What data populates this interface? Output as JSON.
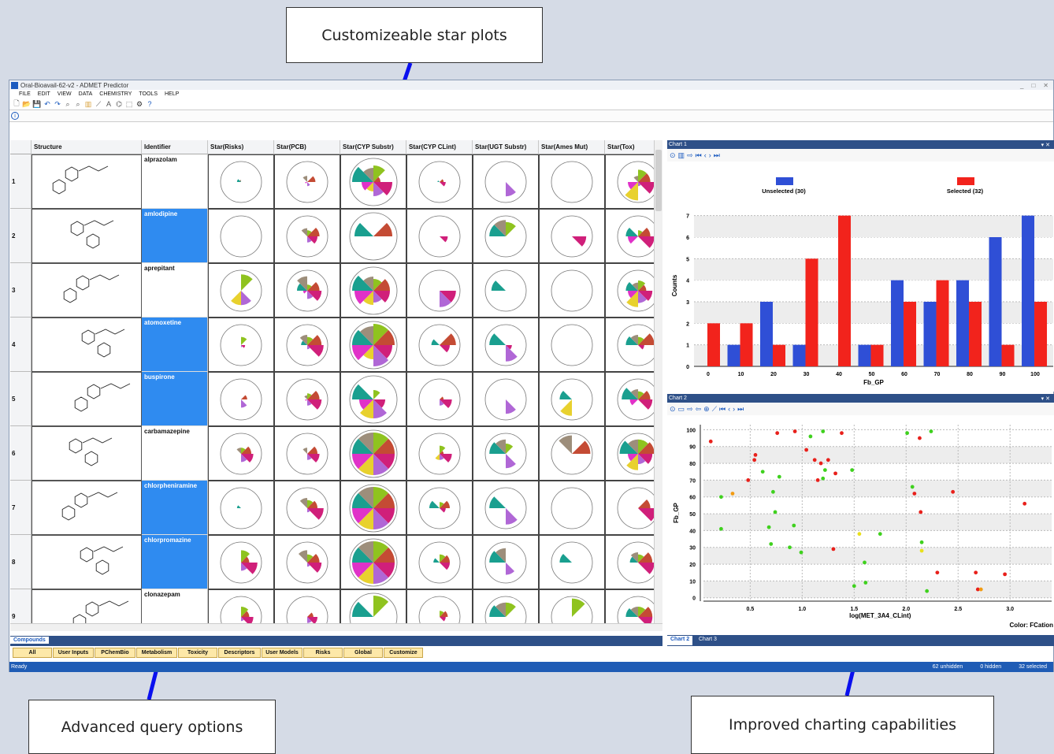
{
  "callouts": {
    "star_plots": "Customizeable star plots",
    "query": "Advanced query options",
    "charting": "Improved charting capabilities"
  },
  "window": {
    "title": "Oral-Bioavail-62-v2 - ADMET Predictor",
    "min": "_",
    "max": "□",
    "close": "✕"
  },
  "menu": [
    "FILE",
    "EDIT",
    "VIEW",
    "DATA",
    "CHEMISTRY",
    "TOOLS",
    "HELP"
  ],
  "toolbar_icons": [
    "new-icon",
    "open-icon",
    "save-icon",
    "undo-icon",
    "redo-icon",
    "find-icon",
    "find-replace-icon",
    "chart-icon",
    "plot-icon",
    "text-icon",
    "structure-icon",
    "select-icon",
    "settings-icon",
    "help-icon"
  ],
  "grid": {
    "headers": [
      "Structure",
      "Identifier",
      "Star(Risks)",
      "Star(PCB)",
      "Star(CYP Substr)",
      "Star(CYP CLint)",
      "Star(UGT Substr)",
      "Star(Ames Mut)",
      "Star(Tox)"
    ],
    "rows": [
      {
        "num": "1",
        "id": "alprazolam",
        "selected": false
      },
      {
        "num": "2",
        "id": "amlodipine",
        "selected": true
      },
      {
        "num": "3",
        "id": "aprepitant",
        "selected": false
      },
      {
        "num": "4",
        "id": "atomoxetine",
        "selected": true
      },
      {
        "num": "5",
        "id": "buspirone",
        "selected": true
      },
      {
        "num": "6",
        "id": "carbamazepine",
        "selected": false
      },
      {
        "num": "7",
        "id": "chlorpheniramine",
        "selected": true
      },
      {
        "num": "8",
        "id": "chlorpromazine",
        "selected": true
      },
      {
        "num": "9",
        "id": "clonazepam",
        "selected": false
      }
    ],
    "star_colors": [
      "#8fc31f",
      "#c44b34",
      "#d01f7a",
      "#b067d6",
      "#e8d12e",
      "#e032c8",
      "#1a9f8f",
      "#9d8e7b"
    ],
    "stars": [
      [
        [
          0,
          0,
          0,
          0,
          0,
          0,
          0.2,
          0.1
        ],
        [
          0,
          0.4,
          0,
          0.2,
          0,
          0.1,
          0,
          0.3
        ],
        [
          0.7,
          0.3,
          0.8,
          0.6,
          0.4,
          0.5,
          0.9,
          0.6
        ],
        [
          0,
          0.2,
          0.3,
          0,
          0,
          0,
          0.1,
          0
        ],
        [
          0,
          0,
          0,
          0.7,
          0,
          0,
          0,
          0
        ],
        [
          0,
          0,
          0,
          0,
          0,
          0,
          0,
          0
        ],
        [
          0.6,
          0.6,
          0.8,
          0.2,
          0.9,
          0.5,
          0,
          0.3
        ]
      ],
      [
        [
          0,
          0,
          0,
          0,
          0,
          0,
          0,
          0
        ],
        [
          0.3,
          0.6,
          0.5,
          0.3,
          0,
          0,
          0,
          0.4
        ],
        [
          0,
          0.8,
          0,
          0,
          0,
          0,
          0.8,
          0
        ],
        [
          0,
          0,
          0.4,
          0,
          0,
          0,
          0,
          0
        ],
        [
          0.7,
          0,
          0,
          0,
          0,
          0,
          0.8,
          0.8
        ],
        [
          0,
          0,
          0.7,
          0,
          0,
          0,
          0,
          0
        ],
        [
          0.3,
          0.6,
          0.8,
          0,
          0,
          0.5,
          0.6,
          0
        ]
      ],
      [
        [
          0.8,
          0,
          0,
          0.7,
          0.7,
          0,
          0,
          0
        ],
        [
          0.3,
          0.6,
          0.7,
          0.4,
          0,
          0.2,
          0.5,
          0.7
        ],
        [
          0.5,
          0.7,
          0.7,
          0.5,
          0.6,
          0.8,
          0.9,
          0.6
        ],
        [
          0,
          0,
          0.8,
          0.8,
          0,
          0,
          0,
          0
        ],
        [
          0,
          0,
          0,
          0,
          0,
          0,
          0.7,
          0
        ],
        [
          0,
          0,
          0,
          0,
          0,
          0,
          0,
          0
        ],
        [
          0.5,
          0.4,
          0.7,
          0.6,
          0.8,
          0.5,
          0.6,
          0.4
        ]
      ],
      [
        [
          0.4,
          0,
          0.2,
          0.1,
          0,
          0,
          0,
          0
        ],
        [
          0.4,
          0.7,
          0.8,
          0.2,
          0,
          0,
          0.3,
          0.5
        ],
        [
          0.9,
          0.9,
          0.8,
          0.9,
          0.6,
          0.9,
          0.9,
          0.8
        ],
        [
          0,
          0.8,
          0.5,
          0,
          0,
          0,
          0.4,
          0
        ],
        [
          0,
          0,
          0.3,
          0.8,
          0,
          0,
          0.8,
          0
        ],
        [
          0,
          0,
          0,
          0,
          0,
          0,
          0,
          0
        ],
        [
          0.4,
          0.8,
          0.3,
          0,
          0,
          0,
          0.6,
          0.5
        ]
      ],
      [
        [
          0,
          0.3,
          0,
          0.4,
          0,
          0,
          0,
          0
        ],
        [
          0.3,
          0.6,
          0.7,
          0.3,
          0,
          0.1,
          0,
          0.2
        ],
        [
          0.4,
          0,
          0.5,
          0.8,
          0.8,
          0.6,
          0.9,
          0
        ],
        [
          0,
          0.2,
          0.6,
          0.3,
          0,
          0,
          0,
          0
        ],
        [
          0,
          0,
          0,
          0.7,
          0,
          0,
          0,
          0
        ],
        [
          0,
          0,
          0,
          0,
          0.8,
          0,
          0.6,
          0
        ],
        [
          0.4,
          0.6,
          0.7,
          0,
          0,
          0.4,
          0.8,
          0.5
        ]
      ],
      [
        [
          0.3,
          0.5,
          0.6,
          0.4,
          0,
          0,
          0,
          0.3
        ],
        [
          0,
          0.5,
          0.6,
          0.3,
          0,
          0,
          0,
          0.3
        ],
        [
          0.9,
          0.9,
          0.9,
          0.9,
          0.9,
          0.9,
          0.9,
          0.9
        ],
        [
          0.4,
          0.2,
          0.6,
          0.3,
          0.3,
          0,
          0,
          0
        ],
        [
          0.5,
          0,
          0,
          0.7,
          0,
          0,
          0.8,
          0.7
        ],
        [
          0,
          0.9,
          0,
          0,
          0,
          0,
          0,
          0.9
        ],
        [
          0.7,
          0.8,
          0.7,
          0.5,
          0.8,
          0.5,
          0.9,
          0.7
        ]
      ],
      [
        [
          0,
          0,
          0,
          0,
          0,
          0,
          0.2,
          0
        ],
        [
          0.4,
          0.5,
          0.8,
          0.2,
          0,
          0,
          0,
          0.5
        ],
        [
          0.9,
          0.9,
          0.9,
          0.9,
          0.9,
          0.9,
          0.9,
          0.9
        ],
        [
          0.3,
          0.5,
          0.3,
          0,
          0,
          0,
          0.5,
          0
        ],
        [
          0,
          0,
          0,
          0.8,
          0,
          0,
          0.8,
          0
        ],
        [
          0,
          0,
          0,
          0,
          0,
          0,
          0,
          0
        ],
        [
          0,
          0.6,
          0.9,
          0,
          0,
          0,
          0,
          0
        ]
      ],
      [
        [
          0.6,
          0.4,
          0.8,
          0.4,
          0,
          0,
          0,
          0
        ],
        [
          0.4,
          0.6,
          0.7,
          0.2,
          0,
          0,
          0,
          0.6
        ],
        [
          0.9,
          0.9,
          0.9,
          0.9,
          0.9,
          0.9,
          0.9,
          0.9
        ],
        [
          0.4,
          0.5,
          0.5,
          0,
          0,
          0,
          0.3,
          0
        ],
        [
          0,
          0,
          0,
          0.6,
          0,
          0,
          0.8,
          0.7
        ],
        [
          0,
          0,
          0,
          0,
          0,
          0,
          0.6,
          0
        ],
        [
          0.4,
          0.7,
          0.8,
          0,
          0,
          0,
          0.4,
          0.5
        ]
      ],
      [
        [
          0.5,
          0.4,
          0.6,
          0.2,
          0,
          0,
          0,
          0
        ],
        [
          0,
          0.3,
          0.5,
          0.3,
          0,
          0,
          0,
          0
        ],
        [
          0.9,
          0,
          0,
          0,
          0,
          0,
          0.9,
          0
        ],
        [
          0.3,
          0.4,
          0.3,
          0,
          0,
          0,
          0,
          0
        ],
        [
          0.7,
          0,
          0,
          0,
          0,
          0,
          0.8,
          0.7
        ],
        [
          0.9,
          0,
          0,
          0,
          0,
          0,
          0,
          0
        ],
        [
          0.5,
          0.7,
          0.7,
          0,
          0,
          0,
          0.6,
          0.5
        ]
      ]
    ]
  },
  "compounds_tab": "Compounds",
  "query_buttons": [
    "All",
    "User Inputs",
    "PChemBio",
    "Metabolism",
    "Toxicity",
    "Descriptors",
    "User Models",
    "Risks",
    "Global",
    "Customize"
  ],
  "status": {
    "ready": "Ready",
    "unhidden": "62 unhidden",
    "hidden": "0 hidden",
    "selected": "32 selected"
  },
  "chart1_title": "Chart 1",
  "chart2_title": "Chart 2",
  "chart2_tabs": [
    "Chart 2",
    "Chart 3"
  ],
  "pane_ctrl": "▾ ✕",
  "chart_data": [
    {
      "type": "bar",
      "xlabel": "Fb_GP",
      "ylabel": "Counts",
      "categories": [
        "0",
        "10",
        "20",
        "30",
        "40",
        "50",
        "60",
        "70",
        "80",
        "90",
        "100"
      ],
      "series": [
        {
          "name": "Unselected (30)",
          "color": "#2f4fd6",
          "values": [
            0,
            1,
            3,
            1,
            0,
            1,
            4,
            3,
            4,
            6,
            7
          ]
        },
        {
          "name": "Selected (32)",
          "color": "#f2231c",
          "values": [
            2,
            2,
            1,
            5,
            7,
            1,
            3,
            4,
            3,
            1,
            3
          ]
        }
      ],
      "yticks": [
        "0",
        "1",
        "2",
        "3",
        "4",
        "5",
        "6",
        "7"
      ],
      "ylim": [
        0,
        7.5
      ],
      "grid": true
    },
    {
      "type": "scatter",
      "xlabel": "log(MET_3A4_CLint)",
      "ylabel": "Fb_GP",
      "color_label": "Color: FCation",
      "xticks": [
        "0.5",
        "1.0",
        "1.5",
        "2.0",
        "2.5",
        "3.0"
      ],
      "yticks": [
        "0",
        "10",
        "20",
        "30",
        "40",
        "50",
        "60",
        "70",
        "80",
        "90",
        "100"
      ],
      "xlim": [
        0.05,
        3.4
      ],
      "ylim": [
        -2,
        103
      ],
      "points": [
        [
          0.12,
          93,
          "#e8201b"
        ],
        [
          0.22,
          60,
          "#3fd11e"
        ],
        [
          0.22,
          41,
          "#3fd11e"
        ],
        [
          0.33,
          62,
          "#f29b12"
        ],
        [
          0.48,
          70,
          "#e8201b"
        ],
        [
          0.55,
          85,
          "#e8201b"
        ],
        [
          0.54,
          82,
          "#e8201b"
        ],
        [
          0.62,
          75,
          "#3fd11e"
        ],
        [
          0.68,
          42,
          "#3fd11e"
        ],
        [
          0.7,
          32,
          "#3fd11e"
        ],
        [
          0.72,
          63,
          "#3fd11e"
        ],
        [
          0.74,
          51,
          "#3fd11e"
        ],
        [
          0.76,
          98,
          "#e8201b"
        ],
        [
          0.78,
          72,
          "#3fd11e"
        ],
        [
          0.88,
          30,
          "#3fd11e"
        ],
        [
          0.92,
          43,
          "#3fd11e"
        ],
        [
          0.93,
          99,
          "#e8201b"
        ],
        [
          0.99,
          27,
          "#3fd11e"
        ],
        [
          1.04,
          88,
          "#e8201b"
        ],
        [
          1.08,
          96,
          "#3fd11e"
        ],
        [
          1.12,
          82,
          "#e8201b"
        ],
        [
          1.15,
          70,
          "#e8201b"
        ],
        [
          1.18,
          80,
          "#e8201b"
        ],
        [
          1.2,
          71,
          "#3fd11e"
        ],
        [
          1.22,
          76,
          "#3fd11e"
        ],
        [
          1.2,
          99,
          "#3fd11e"
        ],
        [
          1.25,
          82,
          "#e8201b"
        ],
        [
          1.3,
          29,
          "#e8201b"
        ],
        [
          1.32,
          74,
          "#e8201b"
        ],
        [
          1.38,
          98,
          "#e8201b"
        ],
        [
          1.48,
          76,
          "#3fd11e"
        ],
        [
          1.5,
          7,
          "#3fd11e"
        ],
        [
          1.55,
          38,
          "#e9e01b"
        ],
        [
          1.6,
          21,
          "#3fd11e"
        ],
        [
          1.61,
          9,
          "#3fd11e"
        ],
        [
          1.75,
          38,
          "#3fd11e"
        ],
        [
          2.01,
          98,
          "#3fd11e"
        ],
        [
          2.06,
          66,
          "#3fd11e"
        ],
        [
          2.08,
          62,
          "#e8201b"
        ],
        [
          2.13,
          95,
          "#e8201b"
        ],
        [
          2.14,
          51,
          "#e8201b"
        ],
        [
          2.15,
          33,
          "#3fd11e"
        ],
        [
          2.15,
          28,
          "#e9e01b"
        ],
        [
          2.2,
          4,
          "#3fd11e"
        ],
        [
          2.24,
          99,
          "#3fd11e"
        ],
        [
          2.3,
          15,
          "#e8201b"
        ],
        [
          2.45,
          63,
          "#e8201b"
        ],
        [
          2.67,
          15,
          "#e8201b"
        ],
        [
          2.69,
          5,
          "#e8201b"
        ],
        [
          2.72,
          5,
          "#f29b12"
        ],
        [
          2.95,
          14,
          "#e8201b"
        ],
        [
          3.14,
          56,
          "#e8201b"
        ]
      ]
    }
  ]
}
